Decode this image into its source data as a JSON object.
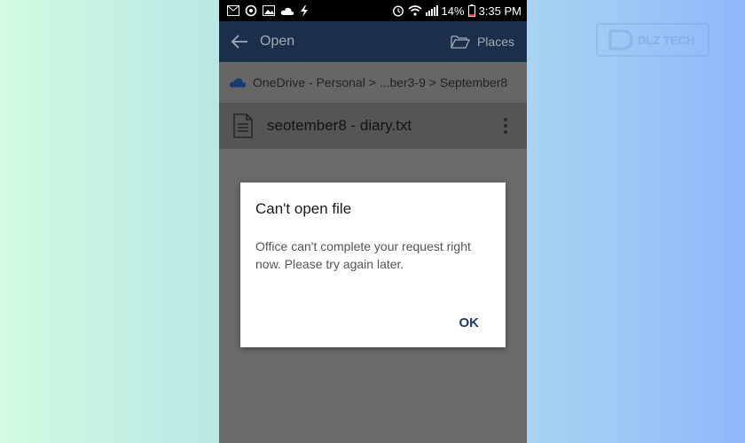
{
  "watermark": {
    "text": "DLZ TECH"
  },
  "status_bar": {
    "battery": "14%",
    "time": "3:35 PM"
  },
  "app_bar": {
    "title": "Open",
    "places_label": "Places"
  },
  "breadcrumb": {
    "path": "OneDrive - Personal > ...ber3-9 > September8"
  },
  "file_list": [
    {
      "name": "seotember8 - diary.txt"
    }
  ],
  "dialog": {
    "title": "Can't open file",
    "message": "Office can't complete your request right now. Please try again later.",
    "ok_label": "OK"
  },
  "colors": {
    "app_bar": "#1c2f4a",
    "accent": "#1e3d66",
    "dim_overlay": "#6a6a6a"
  }
}
